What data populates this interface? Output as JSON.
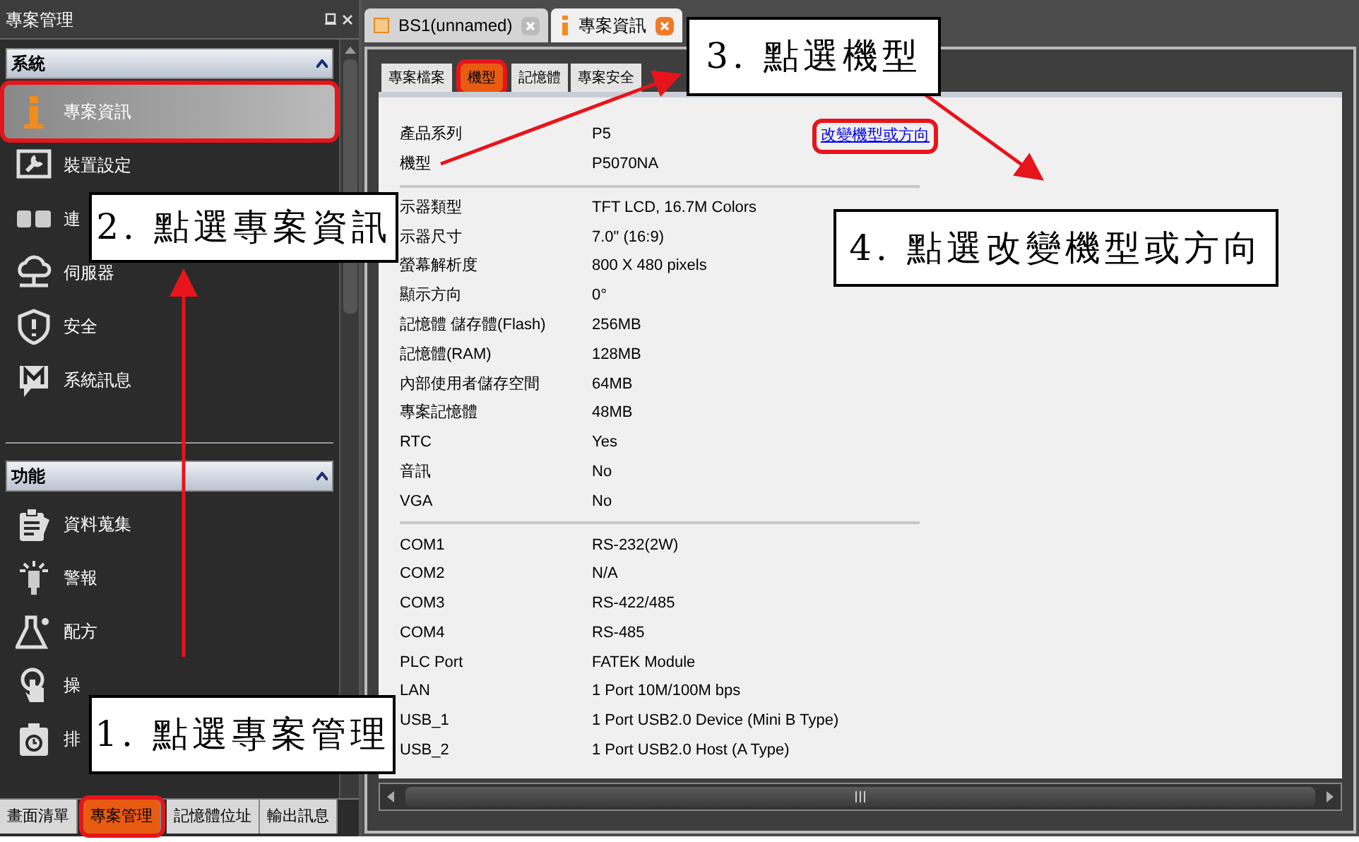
{
  "side_panel": {
    "title": "專案管理",
    "sections": [
      {
        "title": "系統",
        "expanded": true,
        "items": [
          {
            "label": "專案資訊",
            "selected": true
          },
          {
            "label": "裝置設定",
            "selected": false
          },
          {
            "label": "連",
            "selected": false
          },
          {
            "label": "伺服器",
            "selected": false
          },
          {
            "label": "安全",
            "selected": false
          },
          {
            "label": "系統訊息",
            "selected": false
          }
        ]
      },
      {
        "title": "功能",
        "expanded": true,
        "items": [
          {
            "label": "資料蒐集",
            "selected": false
          },
          {
            "label": "警報",
            "selected": false
          },
          {
            "label": "配方",
            "selected": false
          },
          {
            "label": "操",
            "selected": false
          },
          {
            "label": "排",
            "selected": false
          }
        ]
      }
    ],
    "bottom_tabs": [
      {
        "label": "畫面清單",
        "selected": false
      },
      {
        "label": "專案管理",
        "selected": true
      },
      {
        "label": "記憶體位址",
        "selected": false
      },
      {
        "label": "輸出訊息",
        "selected": false
      }
    ]
  },
  "document_tabs": [
    {
      "label": "BS1(unnamed)",
      "selected": false
    },
    {
      "label": "專案資訊",
      "selected": true
    }
  ],
  "info_tabs": [
    {
      "label": "專案檔案",
      "selected": false
    },
    {
      "label": "機型",
      "selected": true
    },
    {
      "label": "記憶體",
      "selected": false
    },
    {
      "label": "專案安全",
      "selected": false
    }
  ],
  "change_link": {
    "text": "改變機型或方向",
    "highlighted": true
  },
  "info_groups": [
    [
      {
        "label": "產品系列",
        "value": "P5"
      },
      {
        "label": "機型",
        "value": "P5070NA"
      }
    ],
    [
      {
        "label": "示器類型",
        "value": "TFT LCD, 16.7M Colors"
      },
      {
        "label": "示器尺寸",
        "value": "7.0\" (16:9)"
      },
      {
        "label": "螢幕解析度",
        "value": "800 X 480 pixels"
      },
      {
        "label": "顯示方向",
        "value": "0°"
      },
      {
        "label": "記憶體 儲存體(Flash)",
        "value": "256MB"
      },
      {
        "label": "記憶體(RAM)",
        "value": "128MB"
      },
      {
        "label": "內部使用者儲存空間",
        "value": "64MB"
      },
      {
        "label": "專案記憶體",
        "value": "48MB"
      },
      {
        "label": "RTC",
        "value": "Yes"
      },
      {
        "label": "音訊",
        "value": "No"
      },
      {
        "label": "VGA",
        "value": "No"
      }
    ],
    [
      {
        "label": "COM1",
        "value": "RS-232(2W)"
      },
      {
        "label": "COM2",
        "value": "N/A"
      },
      {
        "label": "COM3",
        "value": "RS-422/485"
      },
      {
        "label": "COM4",
        "value": "RS-485"
      },
      {
        "label": "PLC Port",
        "value": "FATEK Module"
      },
      {
        "label": "LAN",
        "value": "1 Port 10M/100M bps"
      },
      {
        "label": "USB_1",
        "value": "1 Port USB2.0 Device (Mini B Type)"
      },
      {
        "label": "USB_2",
        "value": "1 Port USB2.0 Host (A Type)"
      }
    ]
  ],
  "callouts": [
    {
      "text": "3. 點選機型"
    },
    {
      "text": "2. 點選專案資訊"
    },
    {
      "text": "4. 點選改變機型或方向"
    },
    {
      "text": "1. 點選專案管理"
    }
  ]
}
